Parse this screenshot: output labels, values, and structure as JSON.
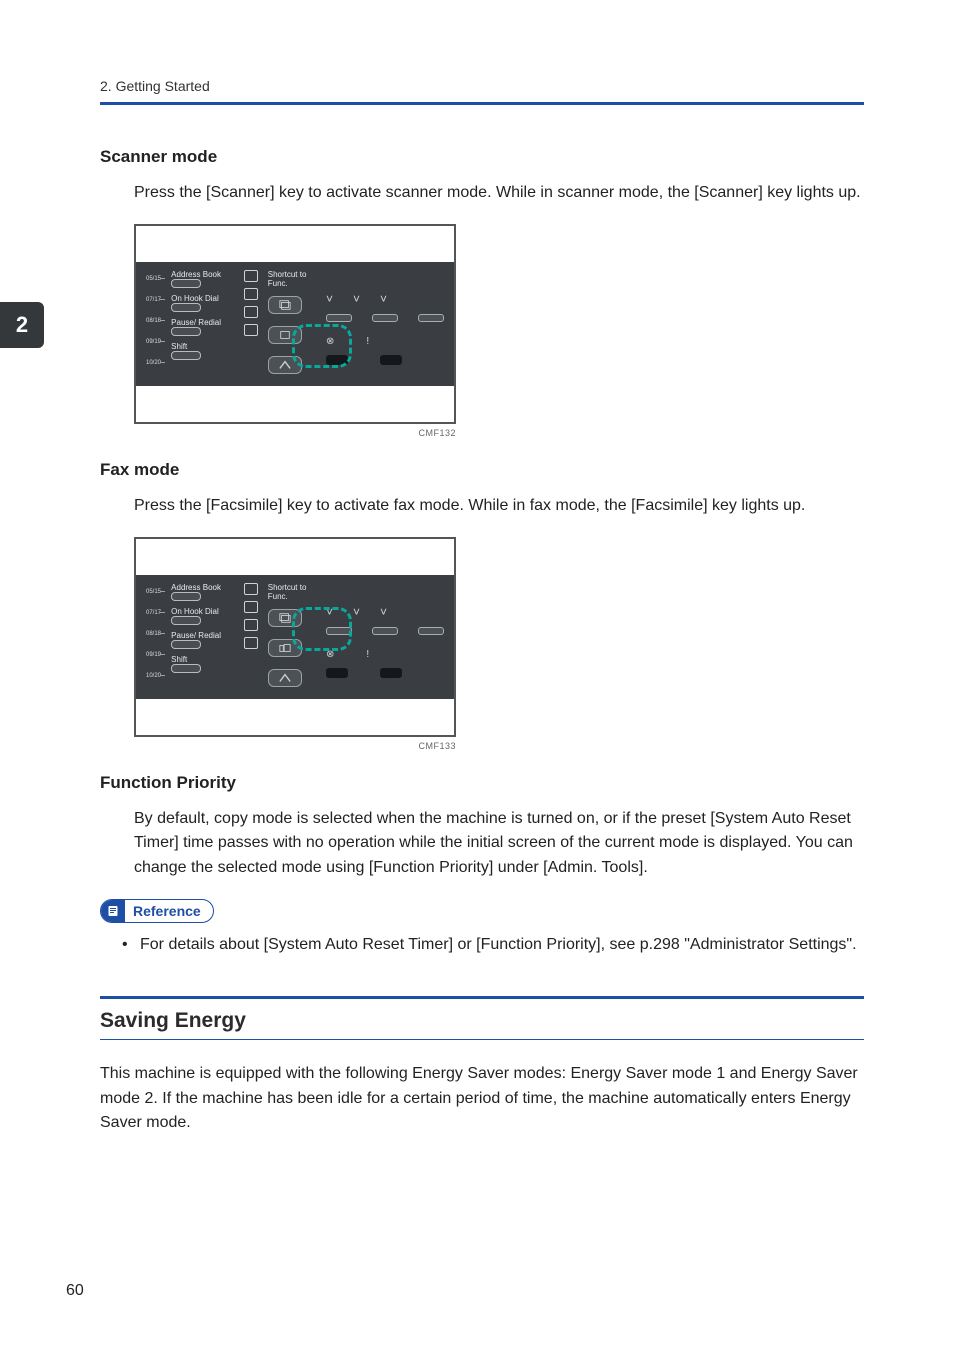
{
  "running_head": "2. Getting Started",
  "chapter_tab": "2",
  "sections": {
    "scanner": {
      "heading": "Scanner mode",
      "body": "Press the [Scanner] key to activate scanner mode. While in scanner mode, the [Scanner] key lights up.",
      "caption": "CMF132"
    },
    "fax": {
      "heading": "Fax mode",
      "body": "Press the [Facsimile] key to activate fax mode. While in fax mode, the [Facsimile] key lights up.",
      "caption": "CMF133"
    },
    "priority": {
      "heading": "Function Priority",
      "body": "By default, copy mode is selected when the machine is turned on, or if the preset [System Auto Reset Timer] time passes with no operation while the initial screen of the current mode is displayed. You can change the selected mode using [Function Priority] under [Admin. Tools]."
    }
  },
  "reference": {
    "label": "Reference",
    "item": "For details about [System Auto Reset Timer] or [Function Priority], see p.298 \"Administrator Settings\"."
  },
  "saving_energy": {
    "title": "Saving Energy",
    "body": "This machine is equipped with the following Energy Saver modes: Energy Saver mode 1 and Energy Saver mode 2. If the machine has been idle for a certain period of time, the machine automatically enters Energy Saver mode."
  },
  "panel": {
    "labels": [
      "Address Book",
      "On Hook Dial",
      "Pause/ Redial",
      "Shift"
    ],
    "shortcut": "Shortcut to Func.",
    "fracs": [
      "05/15",
      "07/17",
      "08/18",
      "09/19",
      "10/20"
    ]
  },
  "page_number": "60"
}
